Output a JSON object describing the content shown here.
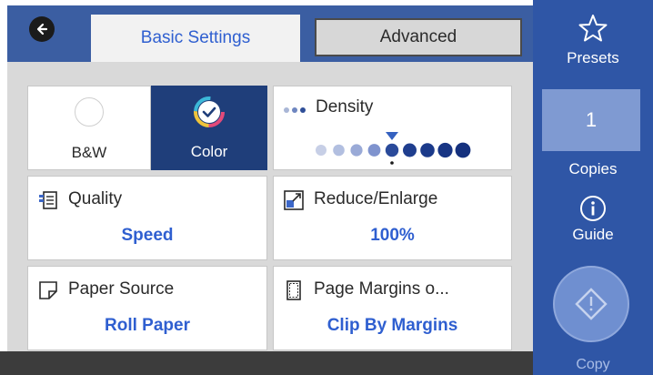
{
  "topbar": {
    "tabs": [
      {
        "label": "Basic Settings",
        "active": true
      },
      {
        "label": "Advanced",
        "active": false
      }
    ]
  },
  "color_mode": {
    "options": [
      {
        "label": "B&W",
        "selected": false
      },
      {
        "label": "Color",
        "selected": true
      }
    ]
  },
  "density": {
    "title": "Density",
    "level": 5,
    "levels_total": 9
  },
  "settings": {
    "quality": {
      "title": "Quality",
      "value": "Speed"
    },
    "reduce_enlarge": {
      "title": "Reduce/Enlarge",
      "value": "100%"
    },
    "paper_source": {
      "title": "Paper Source",
      "value": "Roll Paper"
    },
    "page_margins": {
      "title": "Page Margins o...",
      "value": "Clip By Margins"
    }
  },
  "sidebar": {
    "presets_label": "Presets",
    "copies_value": "1",
    "copies_label": "Copies",
    "guide_label": "Guide",
    "copy_label": "Copy"
  },
  "colors": {
    "sidebar_blue": "#2f56a6",
    "accent_text": "#2f5fd0",
    "selected_mode": "#1f3e7a"
  }
}
